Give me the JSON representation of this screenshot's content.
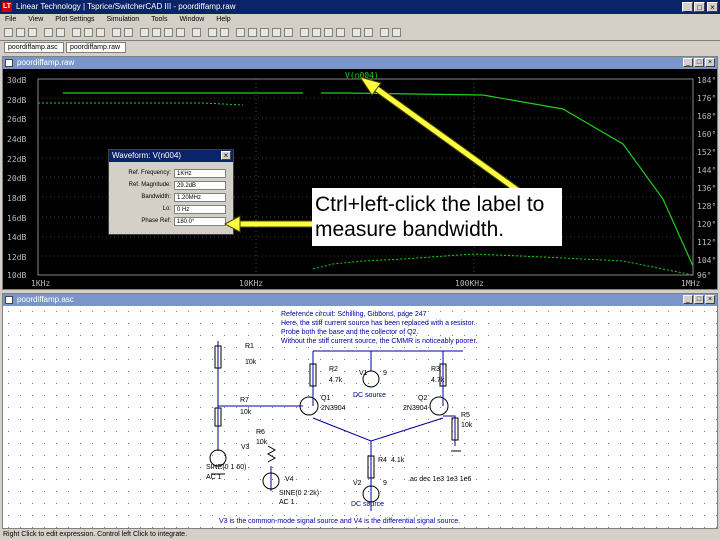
{
  "titlebar": {
    "title": "Linear Technology | Tsprice/SwitcherCAD III - poordiffamp.raw"
  },
  "menubar": {
    "items": [
      "File",
      "View",
      "Plot Settings",
      "Simulation",
      "Tools",
      "Window",
      "Help"
    ]
  },
  "tabs": [
    {
      "label": "poordiffamp.asc"
    },
    {
      "label": "poordiffamp.raw"
    }
  ],
  "waveform": {
    "window_title": "poordiffamp.raw",
    "trace_label": "V(n004)",
    "y_left_ticks": [
      "30dB",
      "26dB",
      "22dB",
      "18dB",
      "14dB",
      "10dB"
    ],
    "y_left_ticks_partial": [
      "28dB",
      "24dB",
      "20dB",
      "16dB",
      "12dB"
    ],
    "y_right_ticks": [
      "184°",
      "176°",
      "168°",
      "160°",
      "152°",
      "144°",
      "136°",
      "128°",
      "120°",
      "112°",
      "104°",
      "96°"
    ],
    "x_ticks": [
      "1KHz",
      "10KHz",
      "100KHz",
      "1MHz"
    ],
    "trace_color": "#1fcf1f"
  },
  "dialog": {
    "title": "Waveform: V(n004)",
    "rows": [
      {
        "label": "Ref. Frequency:",
        "value": "1KHz"
      },
      {
        "label": "Ref. Magnitude:",
        "value": "29.2dB"
      },
      {
        "label": "Bandwidth:",
        "value": "1.20MHz"
      },
      {
        "label": "Lo:",
        "value": "0 Hz"
      },
      {
        "label": "Phase Ref:",
        "value": "180.0°"
      }
    ]
  },
  "annotation": {
    "text": "Ctrl+left-click the label to measure bandwidth."
  },
  "schematic": {
    "window_title": "poordiffamp.asc",
    "header_lines": [
      "Reference circuit: Schilling, Gibbons, page 247",
      "Here, the stiff current source has been replaced with a resistor.",
      "Probe both the base and the collector of Q2.",
      "Without the stiff current source, the CMMR is noticeably poorer."
    ],
    "labels": {
      "r1": "R1",
      "r1v": "10k",
      "r7": "R7",
      "r7v": "10k",
      "r6": "R6",
      "r6v": "10k",
      "r2": "R2",
      "r2v": "4.7k",
      "r3": "R3",
      "r3v": "4.7k",
      "r5": "R5",
      "r5v": "10k",
      "r4": "R4",
      "r4v": "4.1k",
      "q1": "Q1",
      "q1v": "2N3904",
      "q2": "Q2",
      "q2v": "2N3904",
      "v1": "V1",
      "v1v": "9",
      "v2": "V2",
      "v2v": "9",
      "v3": "V3",
      "v3v": "SINE(0 1 60)",
      "v3ac": "AC 1",
      "v4": "V4",
      "v4v": "SINE(0 2 2k)",
      "v4ac": "AC 1",
      "dc1": "DC source",
      "dc2": "DC source",
      "ac_dir": ".ac dec 1e3 1e3 1e6"
    },
    "footer": "V3 is the common-mode signal source and V4 is the differential signal source."
  },
  "status": {
    "text": "Right Click to edit expression. Control left Click to integrate."
  }
}
